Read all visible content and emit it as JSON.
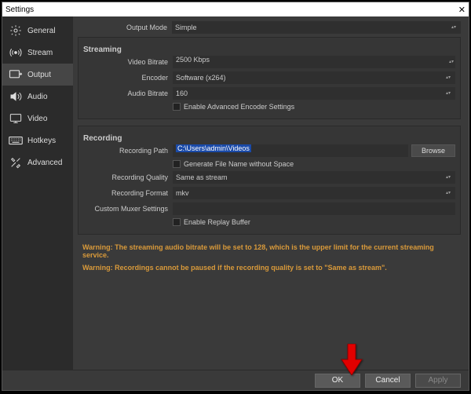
{
  "title": "Settings",
  "sidebar": {
    "items": [
      {
        "label": "General"
      },
      {
        "label": "Stream"
      },
      {
        "label": "Output"
      },
      {
        "label": "Audio"
      },
      {
        "label": "Video"
      },
      {
        "label": "Hotkeys"
      },
      {
        "label": "Advanced"
      }
    ]
  },
  "outputMode": {
    "label": "Output Mode",
    "value": "Simple"
  },
  "streaming": {
    "title": "Streaming",
    "videoBitrate": {
      "label": "Video Bitrate",
      "value": "2500 Kbps"
    },
    "encoder": {
      "label": "Encoder",
      "value": "Software (x264)"
    },
    "audioBitrate": {
      "label": "Audio Bitrate",
      "value": "160"
    },
    "advanced": {
      "label": "Enable Advanced Encoder Settings"
    }
  },
  "recording": {
    "title": "Recording",
    "path": {
      "label": "Recording Path",
      "value": "C:\\Users\\admin\\Videos",
      "browse": "Browse"
    },
    "noSpace": {
      "label": "Generate File Name without Space"
    },
    "quality": {
      "label": "Recording Quality",
      "value": "Same as stream"
    },
    "format": {
      "label": "Recording Format",
      "value": "mkv"
    },
    "muxer": {
      "label": "Custom Muxer Settings",
      "value": ""
    },
    "replay": {
      "label": "Enable Replay Buffer"
    }
  },
  "warnings": [
    "Warning: The streaming audio bitrate will be set to 128, which is the upper limit for the current streaming service.",
    "Warning: Recordings cannot be paused if the recording quality is set to \"Same as stream\"."
  ],
  "footer": {
    "ok": "OK",
    "cancel": "Cancel",
    "apply": "Apply"
  }
}
